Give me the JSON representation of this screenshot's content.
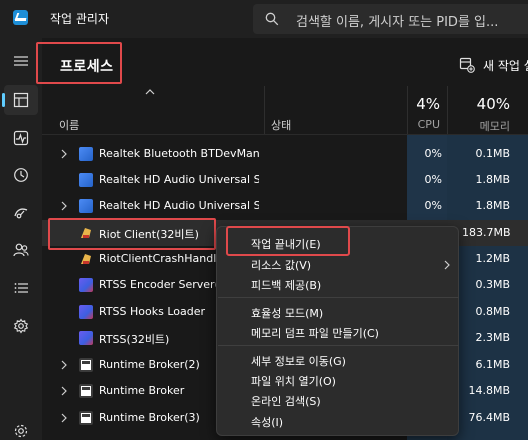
{
  "app": {
    "title": "작업 관리자",
    "search_placeholder": "검색할 이름, 게시자 또는 PID를 입..."
  },
  "page": {
    "title": "프로세스",
    "new_task_label": "새 작업 실"
  },
  "columns": {
    "name": "이름",
    "status": "상태",
    "cpu_percent": "4%",
    "cpu_label": "CPU",
    "memory_percent": "40%",
    "memory_label": "메모리"
  },
  "processes": [
    {
      "name": "Realtek Bluetooth BTDevMan...",
      "expandable": true,
      "icon": "realtek-icon",
      "cpu": "0%",
      "memory": "0.1MB"
    },
    {
      "name": "Realtek HD Audio Universal S...",
      "expandable": false,
      "icon": "realtek-icon",
      "cpu": "0%",
      "memory": "1.8MB"
    },
    {
      "name": "Realtek HD Audio Universal S...",
      "expandable": true,
      "icon": "realtek-icon",
      "cpu": "0%",
      "memory": "1.8MB"
    },
    {
      "name": "Riot Client(32비트)",
      "expandable": false,
      "icon": "riot-icon",
      "cpu": "",
      "memory": "183.7MB"
    },
    {
      "name": "RiotClientCrashHandler",
      "expandable": false,
      "icon": "riot-icon",
      "cpu": "",
      "memory": "1.2MB"
    },
    {
      "name": "RTSS Encoder Server(3",
      "expandable": false,
      "icon": "rtss-icon",
      "cpu": "",
      "memory": "0.3MB"
    },
    {
      "name": "RTSS Hooks Loader",
      "expandable": false,
      "icon": "rtss-icon",
      "cpu": "",
      "memory": "0.8MB"
    },
    {
      "name": "RTSS(32비트)",
      "expandable": false,
      "icon": "rtss-icon",
      "cpu": "",
      "memory": "2.3MB"
    },
    {
      "name": "Runtime Broker(2)",
      "expandable": true,
      "icon": "window-icon",
      "cpu": "",
      "memory": "6.1MB"
    },
    {
      "name": "Runtime Broker",
      "expandable": true,
      "icon": "window-icon",
      "cpu": "",
      "memory": "14.8MB"
    },
    {
      "name": "Runtime Broker(3)",
      "expandable": true,
      "icon": "window-icon",
      "cpu": "",
      "memory": "76.4MB"
    }
  ],
  "context_menu": {
    "end_task": "작업 끝내기(E)",
    "resource_values": "리소스 값(V)",
    "feedback": "피드백 제공(B)",
    "efficiency_mode": "효율성 모드(M)",
    "memory_dump": "메모리 덤프 파일 만들기(C)",
    "go_to_details": "세부 정보로 이동(G)",
    "open_file_location": "파일 위치 열기(O)",
    "search_online": "온라인 검색(S)",
    "properties": "속성(I)"
  },
  "colors": {
    "highlight_red": "#e0494b",
    "accent_blue": "#60cdff",
    "heat_blue": "#1f3448"
  }
}
